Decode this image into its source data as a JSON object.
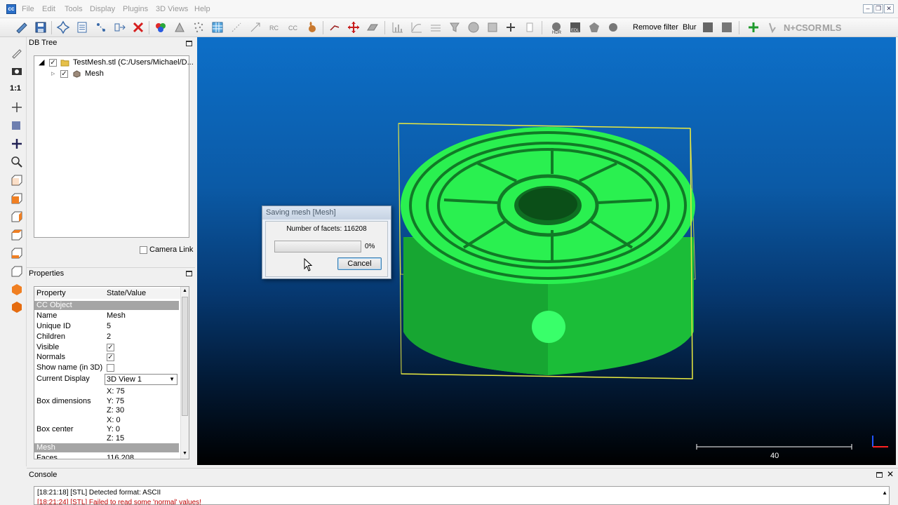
{
  "menubar": {
    "items": [
      "File",
      "Edit",
      "Tools",
      "Display",
      "Plugins",
      "3D Views",
      "Help"
    ]
  },
  "toolbar": {
    "remove_filter_label": "Remove filter",
    "blur_label": "Blur",
    "nc_label": "N+C",
    "sor_label": "SOR",
    "mls_label": "MLS"
  },
  "vtoolbar": {
    "one_to_one_label": "1:1"
  },
  "db_tree": {
    "title": "DB Tree",
    "items": [
      {
        "label": "TestMesh.stl (C:/Users/Michael/D...",
        "checked": true
      },
      {
        "label": "Mesh",
        "checked": true
      }
    ],
    "camera_link_label": "Camera Link"
  },
  "properties": {
    "title": "Properties",
    "header": {
      "property": "Property",
      "value": "State/Value"
    },
    "group_cc_object": "CC Object",
    "name": {
      "key": "Name",
      "value": "Mesh"
    },
    "unique_id": {
      "key": "Unique ID",
      "value": "5"
    },
    "children": {
      "key": "Children",
      "value": "2"
    },
    "visible": {
      "key": "Visible",
      "checked": true
    },
    "normals": {
      "key": "Normals",
      "checked": true
    },
    "show_name": {
      "key": "Show name (in 3D)",
      "checked": false
    },
    "current_display": {
      "key": "Current Display",
      "value": "3D View 1"
    },
    "box_dimensions": {
      "key": "Box dimensions",
      "x": "X: 75",
      "y": "Y: 75",
      "z": "Z: 30"
    },
    "box_center": {
      "key": "Box center",
      "x": "X: 0",
      "y": "Y: 0",
      "z": "Z: 15"
    },
    "group_mesh": "Mesh",
    "faces": {
      "key": "Faces",
      "value": "116 208"
    }
  },
  "view3d": {
    "scale_label": "40"
  },
  "dialog": {
    "title": "Saving mesh [Mesh]",
    "facets_text": "Number of facets: 116208",
    "progress": 0,
    "progress_text": "0%",
    "cancel_label": "Cancel"
  },
  "console": {
    "title": "Console",
    "lines": [
      {
        "text": "[18:21:18] [STL] Detected format: ASCII"
      },
      {
        "text": "[18:21:24] [STL] Failed to read some 'normal' values!"
      }
    ]
  },
  "colors": {
    "mesh_green": "#2af050",
    "bbox_yellow": "#e8e840",
    "error_text": "#c00000",
    "progress_green": "#38b24a"
  }
}
